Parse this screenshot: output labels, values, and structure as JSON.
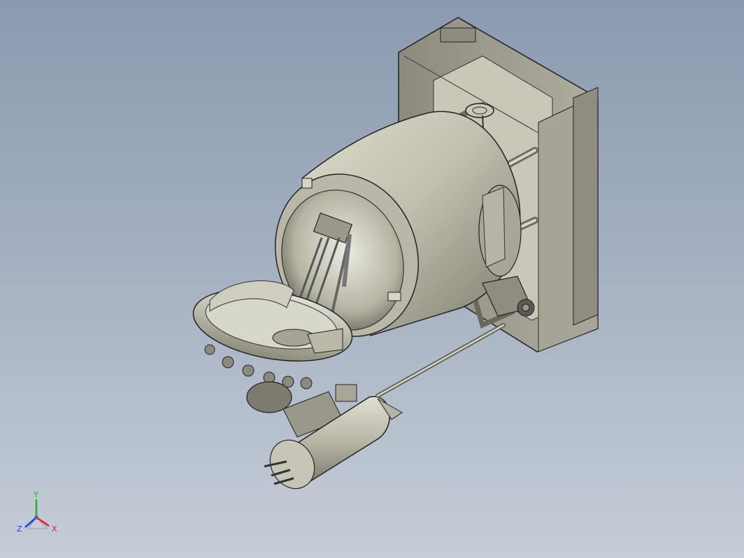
{
  "viewport": {
    "background_top": "#8b9ab0",
    "background_bottom": "#c6cdd8"
  },
  "model": {
    "body_color": "#bdbcae",
    "frame_color": "#9c9a8e",
    "edge_color": "#222222"
  },
  "triad": {
    "x_label": "X",
    "y_label": "Y",
    "z_label": "Z",
    "x_color": "#e02020",
    "y_color": "#20b020",
    "z_color": "#2040e0"
  }
}
